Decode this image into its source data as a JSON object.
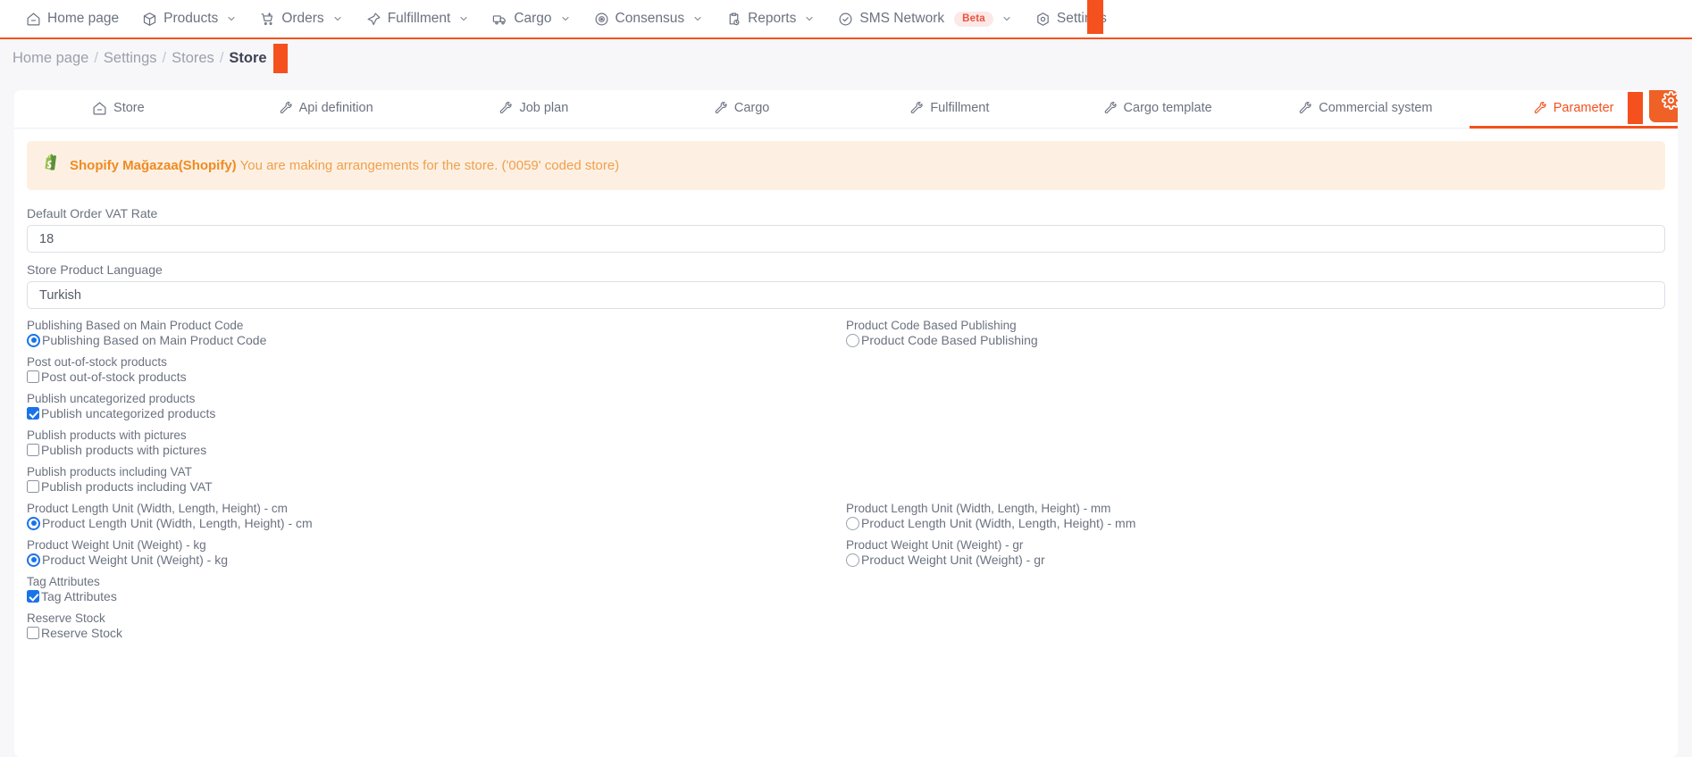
{
  "colors": {
    "accent": "#f4511e",
    "gear_button": "#ef6126",
    "alert_bg": "#fdf0e3",
    "alert_text": "#f0a04b",
    "alert_strong": "#ef8b22",
    "control_blue": "#1a73e8",
    "nav_text": "#6b7280",
    "page_bg": "#f7f7f9"
  },
  "topnav": {
    "items": [
      {
        "label": "Home page",
        "icon": "home-icon",
        "has_chevron": false,
        "badge": null
      },
      {
        "label": "Products",
        "icon": "box-icon",
        "has_chevron": true,
        "badge": null
      },
      {
        "label": "Orders",
        "icon": "cart-plus-icon",
        "has_chevron": true,
        "badge": null
      },
      {
        "label": "Fulfillment",
        "icon": "pin-icon",
        "has_chevron": true,
        "badge": null
      },
      {
        "label": "Cargo",
        "icon": "truck-icon",
        "has_chevron": true,
        "badge": null
      },
      {
        "label": "Consensus",
        "icon": "target-icon",
        "has_chevron": true,
        "badge": null
      },
      {
        "label": "Reports",
        "icon": "clipboard-clock-icon",
        "has_chevron": true,
        "badge": null
      },
      {
        "label": "SMS Network",
        "icon": "check-circle-icon",
        "has_chevron": true,
        "badge": "Beta"
      },
      {
        "label": "Settings",
        "icon": "hexagon-gear-icon",
        "has_chevron": false,
        "badge": null
      }
    ]
  },
  "breadcrumb": {
    "items": [
      "Home page",
      "Settings",
      "Stores",
      "Store"
    ],
    "separator": "/",
    "active_index": 3
  },
  "tabs": {
    "items": [
      {
        "label": "Store",
        "icon": "home-icon"
      },
      {
        "label": "Api definition",
        "icon": "wrench-icon"
      },
      {
        "label": "Job plan",
        "icon": "wrench-icon"
      },
      {
        "label": "Cargo",
        "icon": "wrench-icon"
      },
      {
        "label": "Fulfillment",
        "icon": "wrench-icon"
      },
      {
        "label": "Cargo template",
        "icon": "wrench-icon"
      },
      {
        "label": "Commercial system",
        "icon": "wrench-icon"
      },
      {
        "label": "Parameter",
        "icon": "wrench-icon"
      }
    ],
    "active_index": 7
  },
  "gear_button": {
    "icon": "gear-icon"
  },
  "alert": {
    "icon": "shopify-bag-icon",
    "strong": "Shopify Mağazaa(Shopify)",
    "text": "You are making arrangements for the store. ('0059' coded store)"
  },
  "fields": [
    {
      "label": "Default Order VAT Rate",
      "value": "18",
      "placeholder": ""
    },
    {
      "label": "Store Product Language",
      "value": "Turkish",
      "placeholder": ""
    }
  ],
  "options": [
    {
      "left": {
        "title": "Publishing Based on Main Product Code",
        "label": "Publishing Based on Main Product Code",
        "type": "radio",
        "checked": true
      },
      "right": {
        "title": "Product Code Based Publishing",
        "label": "Product Code Based Publishing",
        "type": "radio",
        "checked": false
      },
      "cursor": false
    },
    {
      "left": {
        "title": "Post out-of-stock products",
        "label": "Post out-of-stock products",
        "type": "checkbox",
        "checked": false
      },
      "right": null,
      "cursor": false
    },
    {
      "left": {
        "title": "Publish uncategorized products",
        "label": "Publish uncategorized products",
        "type": "checkbox",
        "checked": true
      },
      "right": null,
      "cursor": true
    },
    {
      "left": {
        "title": "Publish products with pictures",
        "label": "Publish products with pictures",
        "type": "checkbox",
        "checked": false
      },
      "right": null,
      "cursor": false
    },
    {
      "left": {
        "title": "Publish products including VAT",
        "label": "Publish products including VAT",
        "type": "checkbox",
        "checked": false
      },
      "right": null,
      "cursor": false
    },
    {
      "left": {
        "title": "Product Length Unit (Width, Length, Height) - cm",
        "label": "Product Length Unit (Width, Length, Height) - cm",
        "type": "radio",
        "checked": true
      },
      "right": {
        "title": "Product Length Unit (Width, Length, Height) - mm",
        "label": "Product Length Unit (Width, Length, Height) - mm",
        "type": "radio",
        "checked": false
      },
      "cursor": false
    },
    {
      "left": {
        "title": "Product Weight Unit (Weight) - kg",
        "label": "Product Weight Unit (Weight) - kg",
        "type": "radio",
        "checked": true
      },
      "right": {
        "title": "Product Weight Unit (Weight) - gr",
        "label": "Product Weight Unit (Weight) - gr",
        "type": "radio",
        "checked": false
      },
      "cursor": false
    },
    {
      "left": {
        "title": "Tag Attributes",
        "label": "Tag Attributes",
        "type": "checkbox",
        "checked": true
      },
      "right": null,
      "cursor": true
    },
    {
      "left": {
        "title": "Reserve Stock",
        "label": "Reserve Stock",
        "type": "checkbox",
        "checked": false
      },
      "right": null,
      "cursor": false
    }
  ]
}
